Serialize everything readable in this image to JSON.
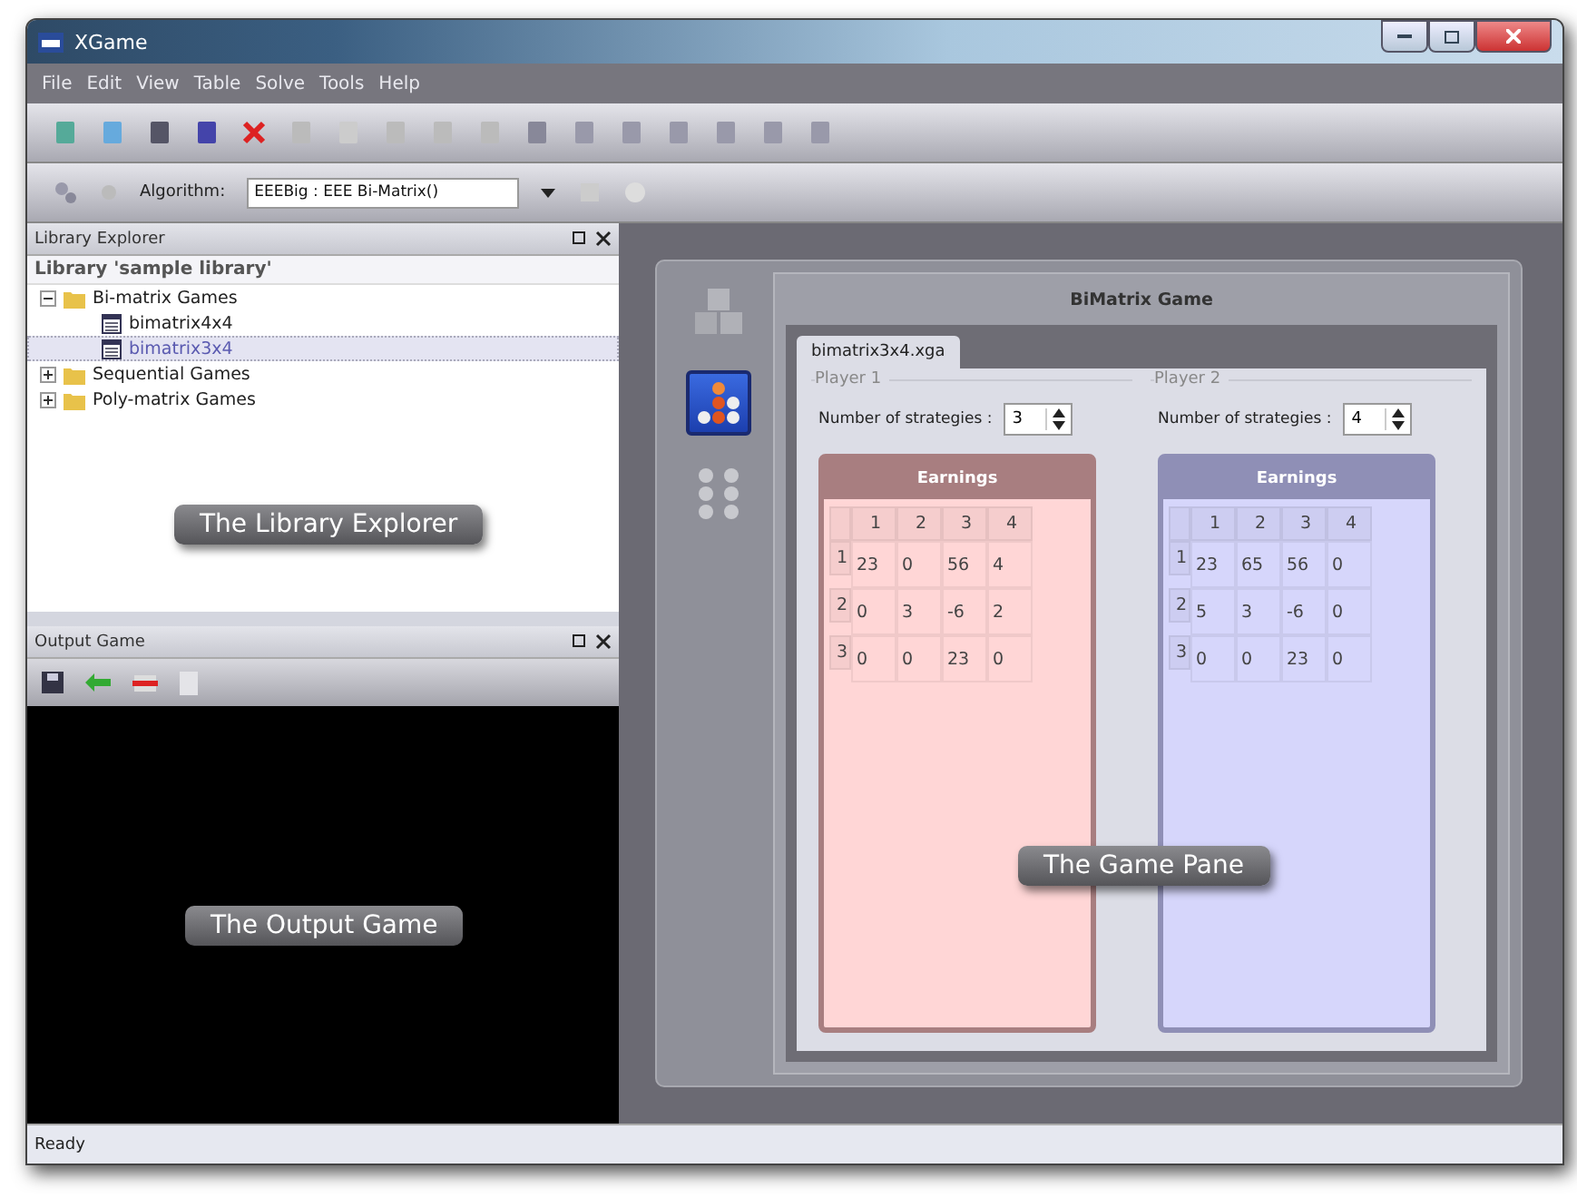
{
  "window": {
    "title": "XGame"
  },
  "menu": [
    "File",
    "Edit",
    "View",
    "Table",
    "Solve",
    "Tools",
    "Help"
  ],
  "algorithm": {
    "label": "Algorithm:",
    "value": "EEEBig : EEE Bi-Matrix()"
  },
  "library_explorer": {
    "title": "Library Explorer",
    "library": "Library 'sample library'",
    "callout": "The Library Explorer",
    "tree": [
      {
        "label": "Bi-matrix Games",
        "kind": "folder",
        "expanded": true,
        "selected": false,
        "children": [
          {
            "label": "bimatrix4x4",
            "kind": "file",
            "selected": false
          },
          {
            "label": "bimatrix3x4",
            "kind": "file",
            "selected": true
          }
        ]
      },
      {
        "label": "Sequential Games",
        "kind": "folder",
        "expanded": false,
        "selected": false
      },
      {
        "label": "Poly-matrix Games",
        "kind": "folder",
        "expanded": false,
        "selected": false
      }
    ]
  },
  "output_game": {
    "title": "Output Game",
    "callout": "The Output Game"
  },
  "game_pane": {
    "callout": "The Game Pane",
    "title": "BiMatrix Game",
    "tab": "bimatrix3x4.xga",
    "side_icons": [
      {
        "kind": "cubes",
        "selected": false
      },
      {
        "kind": "matrix",
        "selected": true
      },
      {
        "kind": "tree",
        "selected": false
      }
    ],
    "players": [
      {
        "label": "Player 1",
        "strategies_label": "Number of strategies :",
        "strategies": "3",
        "earnings": "Earnings",
        "color": "#ffd6d6",
        "columns": [
          "1",
          "2",
          "3",
          "4"
        ],
        "rows": [
          {
            "label": "1",
            "cells": [
              "23",
              "0",
              "56",
              "4"
            ]
          },
          {
            "label": "2",
            "cells": [
              "0",
              "3",
              "-6",
              "2"
            ]
          },
          {
            "label": "3",
            "cells": [
              "0",
              "0",
              "23",
              "0"
            ]
          }
        ]
      },
      {
        "label": "Player 2",
        "strategies_label": "Number of strategies :",
        "strategies": "4",
        "earnings": "Earnings",
        "color": "#d6d6fb",
        "columns": [
          "1",
          "2",
          "3",
          "4"
        ],
        "rows": [
          {
            "label": "1",
            "cells": [
              "23",
              "65",
              "56",
              "0"
            ]
          },
          {
            "label": "2",
            "cells": [
              "5",
              "3",
              "-6",
              "0"
            ]
          },
          {
            "label": "3",
            "cells": [
              "0",
              "0",
              "23",
              "0"
            ]
          }
        ]
      }
    ]
  },
  "status_bar": "Ready"
}
